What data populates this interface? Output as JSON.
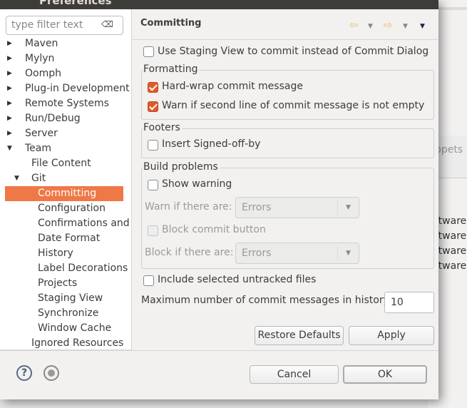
{
  "window": {
    "title": "Preferences"
  },
  "filter": {
    "placeholder": "type filter text",
    "clear_icon": "clear-icon"
  },
  "tree": {
    "items": [
      {
        "label": "Maven",
        "expanded": false
      },
      {
        "label": "Mylyn",
        "expanded": false
      },
      {
        "label": "Oomph",
        "expanded": false
      },
      {
        "label": "Plug-in Development",
        "expanded": false
      },
      {
        "label": "Remote Systems",
        "expanded": false
      },
      {
        "label": "Run/Debug",
        "expanded": false
      },
      {
        "label": "Server",
        "expanded": false
      },
      {
        "label": "Team",
        "expanded": true
      },
      {
        "label": "File Content"
      },
      {
        "label": "Git",
        "expanded": true
      },
      {
        "label": "Committing",
        "selected": true
      },
      {
        "label": "Configuration"
      },
      {
        "label": "Confirmations and"
      },
      {
        "label": "Date Format"
      },
      {
        "label": "History"
      },
      {
        "label": "Label Decorations"
      },
      {
        "label": "Projects"
      },
      {
        "label": "Staging View"
      },
      {
        "label": "Synchronize"
      },
      {
        "label": "Window Cache"
      },
      {
        "label": "Ignored Resources"
      }
    ],
    "selection_color": "#f07746"
  },
  "page": {
    "title": "Committing",
    "use_staging": {
      "label": "Use Staging View to commit instead of Commit Dialog",
      "checked": false
    },
    "formatting": {
      "title": "Formatting",
      "hard_wrap": {
        "label": "Hard-wrap commit message",
        "checked": true
      },
      "warn_second_line": {
        "label": "Warn if second line of commit message is not empty",
        "checked": true
      }
    },
    "footers": {
      "title": "Footers",
      "signed_off": {
        "label": "Insert Signed-off-by",
        "checked": false
      }
    },
    "build_problems": {
      "title": "Build problems",
      "show_warning": {
        "label": "Show warning",
        "checked": false
      },
      "warn_label": "Warn if there are:",
      "warn_value": "Errors",
      "block_commit": {
        "label": "Block commit button",
        "checked": false,
        "disabled": true
      },
      "block_label": "Block if there are:",
      "block_value": "Errors"
    },
    "include_untracked": {
      "label": "Include selected untracked files",
      "checked": false
    },
    "history_label": "Maximum number of commit messages in history:",
    "history_value": "10",
    "restore_defaults": "Restore Defaults",
    "apply": "Apply"
  },
  "footer": {
    "cancel": "Cancel",
    "ok": "OK",
    "help_icon": "?"
  },
  "background": {
    "tab_text": "ppets",
    "rows": [
      "ftware",
      "ftware",
      "ftware",
      "ftware"
    ]
  },
  "colors": {
    "checked": "#e05a2c",
    "titlebar": "#3d3c38"
  }
}
